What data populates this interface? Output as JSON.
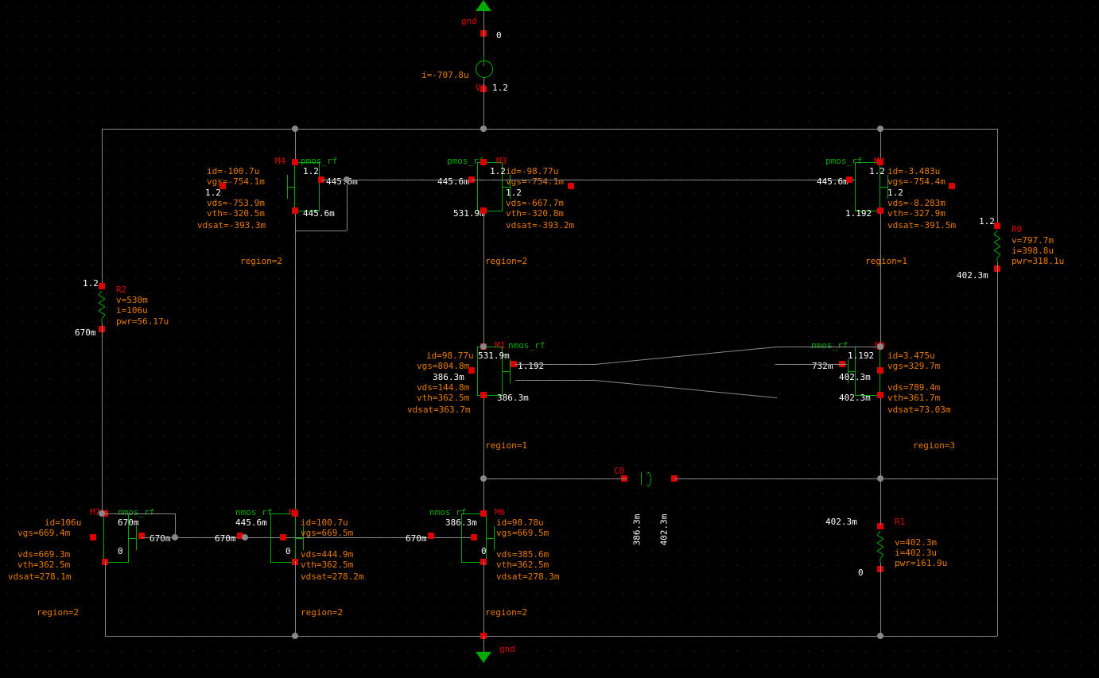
{
  "gnd_top": {
    "label": "gnd",
    "val": "0"
  },
  "gnd_bot": {
    "label": "gnd"
  },
  "V0": {
    "name": "V0",
    "i": "i=-707.8u",
    "v": "1.2"
  },
  "C0": {
    "name": "C0",
    "n1": "386.3m",
    "n2": "402.3m"
  },
  "R0": {
    "name": "R0",
    "v": "v=797.7m",
    "i": "i=398.8u",
    "pwr": "pwr=318.1u",
    "top": "1.2",
    "bot": "402.3m"
  },
  "R1": {
    "name": "R1",
    "v": "v=402.3m",
    "i": "i=402.3u",
    "pwr": "pwr=161.9u",
    "top": "402.3m",
    "bot": "0"
  },
  "R2": {
    "name": "R2",
    "v": "v=530m",
    "i": "i=106u",
    "pwr": "pwr=56.17u",
    "top": "1.2",
    "bot": "670m"
  },
  "M4": {
    "name": "M4",
    "type": "pmos_rf",
    "id": "id=-100.7u",
    "vgs": "vgs=-754.1m",
    "vds": "vds=-753.9m",
    "vth": "vth=-320.5m",
    "vdsat": "vdsat=-393.3m",
    "region": "region=2",
    "nS": "1.2",
    "nG": "445.6m",
    "nB": "1.2",
    "nD": "445.6m"
  },
  "M3": {
    "name": "M3",
    "type": "pmos_rf",
    "id": "id=-98.77u",
    "vgs": "vgs=-754.1m",
    "vds": "vds=-667.7m",
    "vth": "vth=-320.8m",
    "vdsat": "vdsat=-393.2m",
    "region": "region=2",
    "nS": "1.2",
    "nG": "445.6m",
    "nB": "1.2",
    "nD": "531.9m"
  },
  "M2": {
    "name": "M2",
    "type": "pmos_rf",
    "id": "id=-3.483u",
    "vgs": "vgs=-754.4m",
    "vds": "vds=-8.283m",
    "vth": "vth=-327.9m",
    "vdsat": "vdsat=-391.5m",
    "region": "region=1",
    "nS": "1.2",
    "nG": "445.6m",
    "nB": "1.2",
    "nD": "1.192"
  },
  "M1": {
    "name": "M1",
    "type": "nmos_rf",
    "id": "id=98.77u",
    "vgs": "vgs=804.8m",
    "vds": "vds=144.8m",
    "vth": "vth=362.5m",
    "vdsat": "vdsat=363.7m",
    "region": "region=1",
    "nD": "531.9m",
    "nG": "1.192",
    "nB": "386.3m",
    "nS": "386.3m"
  },
  "M0": {
    "name": "M0",
    "type": "nmos_rf",
    "id": "id=3.475u",
    "vgs": "vgs=329.7m",
    "vds": "vds=789.4m",
    "vth": "vth=361.7m",
    "vdsat": "vdsat=73.03m",
    "region": "region=3",
    "nD": "1.192",
    "nG": "732m",
    "nB": "402.3m",
    "nS": "402.3m"
  },
  "M7": {
    "name": "M7",
    "type": "nmos_rf",
    "id": "id=106u",
    "vgs": "vgs=669.4m",
    "vds": "vds=669.3m",
    "vth": "vth=362.5m",
    "vdsat": "vdsat=278.1m",
    "region": "region=2",
    "nD": "670m",
    "nG": "670m",
    "nB": "0",
    "nS": "0"
  },
  "M5": {
    "name": "M5",
    "type": "nmos_rf",
    "id": "id=100.7u",
    "vgs": "vgs=669.5m",
    "vds": "vds=444.9m",
    "vth": "vth=362.5m",
    "vdsat": "vdsat=278.2m",
    "region": "region=2",
    "nD": "445.6m",
    "nG": "670m",
    "nB": "0",
    "nS": "0"
  },
  "M6": {
    "name": "M6",
    "type": "nmos_rf",
    "id": "id=98.78u",
    "vgs": "vgs=669.5m",
    "vds": "vds=385.6m",
    "vth": "vth=362.5m",
    "vdsat": "vdsat=278.3m",
    "region": "region=2",
    "nD": "386.3m",
    "nG": "670m",
    "nB": "0",
    "nS": "0"
  }
}
